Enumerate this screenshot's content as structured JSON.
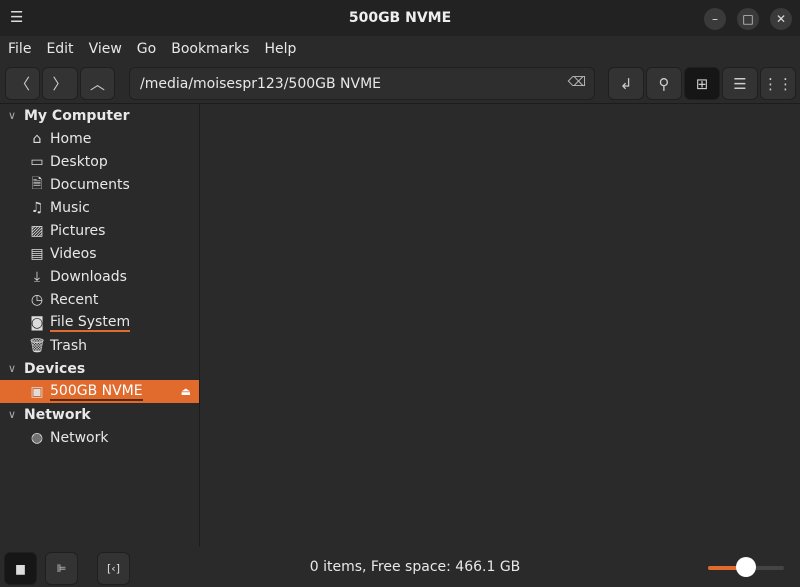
{
  "window": {
    "title": "500GB NVME",
    "menu_icon": "hamburger-icon"
  },
  "menubar": [
    "File",
    "Edit",
    "View",
    "Go",
    "Bookmarks",
    "Help"
  ],
  "toolbar": {
    "path": "/media/moisespr123/500GB NVME",
    "view_mode": "icon-view"
  },
  "sidebar": {
    "sections": [
      {
        "title": "My Computer",
        "items": [
          {
            "label": "Home",
            "icon": "home-icon",
            "glyph": "⌂"
          },
          {
            "label": "Desktop",
            "icon": "desktop-icon",
            "glyph": "▭"
          },
          {
            "label": "Documents",
            "icon": "documents-icon",
            "glyph": "🗎"
          },
          {
            "label": "Music",
            "icon": "music-icon",
            "glyph": "♫"
          },
          {
            "label": "Pictures",
            "icon": "pictures-icon",
            "glyph": "▨"
          },
          {
            "label": "Videos",
            "icon": "videos-icon",
            "glyph": "▤"
          },
          {
            "label": "Downloads",
            "icon": "downloads-icon",
            "glyph": "⤓"
          },
          {
            "label": "Recent",
            "icon": "recent-icon",
            "glyph": "◷"
          },
          {
            "label": "File System",
            "icon": "filesystem-icon",
            "glyph": "◙"
          },
          {
            "label": "Trash",
            "icon": "trash-icon",
            "glyph": "🗑"
          }
        ]
      },
      {
        "title": "Devices",
        "items": [
          {
            "label": "500GB NVME",
            "icon": "drive-icon",
            "glyph": "▣",
            "selected": true
          }
        ]
      },
      {
        "title": "Network",
        "items": [
          {
            "label": "Network",
            "icon": "network-icon",
            "glyph": "◍"
          }
        ]
      }
    ]
  },
  "status": {
    "text": "0 items, Free space: 466.1 GB",
    "zoom_level": 0.5
  },
  "colors": {
    "accent": "#e06b2d"
  }
}
